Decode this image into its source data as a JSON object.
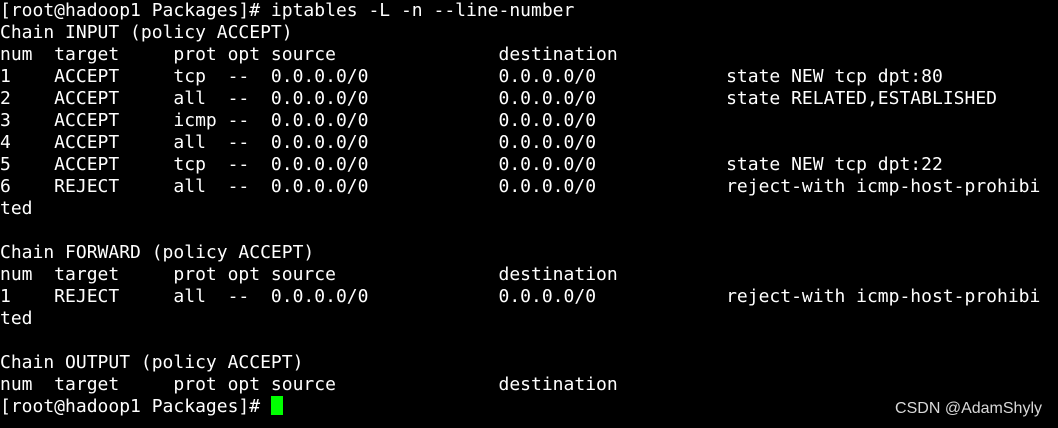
{
  "terminal": {
    "lines": [
      "[root@hadoop1 Packages]# iptables -L -n --line-number",
      "Chain INPUT (policy ACCEPT)",
      "num  target     prot opt source               destination",
      "1    ACCEPT     tcp  --  0.0.0.0/0            0.0.0.0/0            state NEW tcp dpt:80",
      "2    ACCEPT     all  --  0.0.0.0/0            0.0.0.0/0            state RELATED,ESTABLISHED",
      "3    ACCEPT     icmp --  0.0.0.0/0            0.0.0.0/0",
      "4    ACCEPT     all  --  0.0.0.0/0            0.0.0.0/0",
      "5    ACCEPT     tcp  --  0.0.0.0/0            0.0.0.0/0            state NEW tcp dpt:22",
      "6    REJECT     all  --  0.0.0.0/0            0.0.0.0/0            reject-with icmp-host-prohibi",
      "ted",
      "",
      "Chain FORWARD (policy ACCEPT)",
      "num  target     prot opt source               destination",
      "1    REJECT     all  --  0.0.0.0/0            0.0.0.0/0            reject-with icmp-host-prohibi",
      "ted",
      "",
      "Chain OUTPUT (policy ACCEPT)",
      "num  target     prot opt source               destination"
    ],
    "prompt": "[root@hadoop1 Packages]# ",
    "cursor_color": "#00ff00",
    "background": "#000000",
    "foreground": "#ffffff"
  },
  "watermark": "CSDN @AdamShyly"
}
